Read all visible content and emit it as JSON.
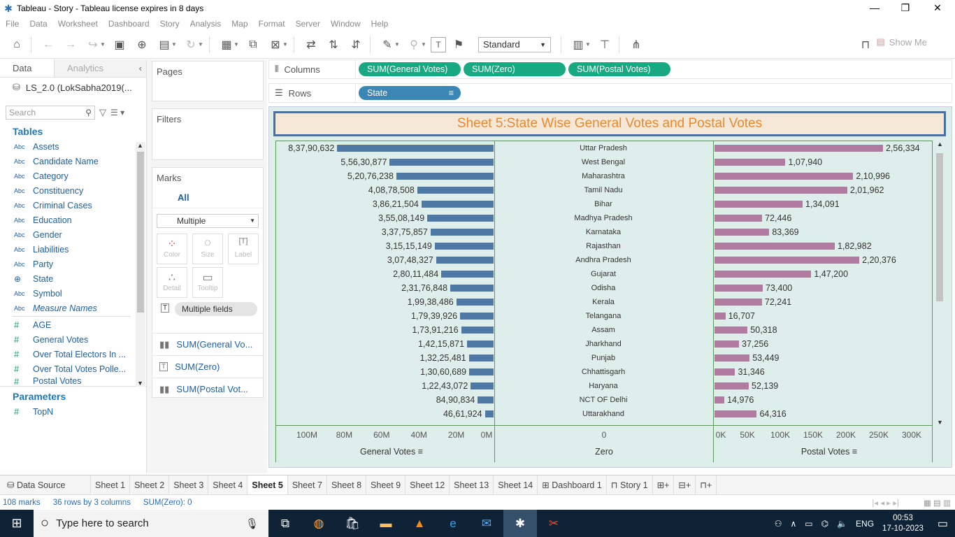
{
  "window": {
    "title": "Tableau - Story - Tableau license expires in 8 days"
  },
  "menu": [
    "File",
    "Data",
    "Worksheet",
    "Dashboard",
    "Story",
    "Analysis",
    "Map",
    "Format",
    "Server",
    "Window",
    "Help"
  ],
  "toolbar": {
    "fit_select": "Standard",
    "show_me": "Show Me"
  },
  "data_pane": {
    "tab_data": "Data",
    "tab_analytics": "Analytics",
    "datasource": "LS_2.0 (LokSabha2019(...",
    "search_placeholder": "Search",
    "tables_title": "Tables",
    "dimensions": [
      {
        "type": "Abc",
        "name": "Assets"
      },
      {
        "type": "Abc",
        "name": "Candidate Name"
      },
      {
        "type": "Abc",
        "name": "Category"
      },
      {
        "type": "Abc",
        "name": "Constituency"
      },
      {
        "type": "Abc",
        "name": "Criminal Cases"
      },
      {
        "type": "Abc",
        "name": "Education"
      },
      {
        "type": "Abc",
        "name": "Gender"
      },
      {
        "type": "Abc",
        "name": "Liabilities"
      },
      {
        "type": "Abc",
        "name": "Party"
      },
      {
        "type": "globe",
        "name": "State"
      },
      {
        "type": "Abc",
        "name": "Symbol"
      },
      {
        "type": "Abc",
        "name": "Measure Names"
      }
    ],
    "measures": [
      {
        "type": "#",
        "name": "AGE"
      },
      {
        "type": "#",
        "name": "General Votes"
      },
      {
        "type": "#",
        "name": "Over Total Electors  In ..."
      },
      {
        "type": "#",
        "name": "Over Total Votes Polle..."
      },
      {
        "type": "#",
        "name": "Postal Votes"
      }
    ],
    "parameters_title": "Parameters",
    "parameters": [
      {
        "type": "#",
        "name": "TopN"
      }
    ]
  },
  "shelves": {
    "pages": "Pages",
    "filters": "Filters",
    "marks": "Marks",
    "marks_all": "All",
    "marks_type": "Multiple",
    "mark_buttons": [
      "Color",
      "Size",
      "Label",
      "Detail",
      "Tooltip"
    ],
    "multiple_fields": "Multiple fields",
    "mark_rows": [
      "SUM(General Vo...",
      "SUM(Zero)",
      "SUM(Postal Vot..."
    ],
    "columns_label": "Columns",
    "columns_pills": [
      "SUM(General Votes)",
      "SUM(Zero)",
      "SUM(Postal Votes)"
    ],
    "rows_label": "Rows",
    "rows_pills": [
      "State"
    ]
  },
  "sheet": {
    "title": "Sheet 5:State Wise General Votes and Postal Votes"
  },
  "chart_data": {
    "type": "bar",
    "title": "Sheet 5:State Wise General Votes and Postal Votes",
    "categories": [
      "Uttar Pradesh",
      "West Bengal",
      "Maharashtra",
      "Tamil Nadu",
      "Bihar",
      "Madhya Pradesh",
      "Karnataka",
      "Rajasthan",
      "Andhra Pradesh",
      "Gujarat",
      "Odisha",
      "Kerala",
      "Telangana",
      "Assam",
      "Jharkhand",
      "Punjab",
      "Chhattisgarh",
      "Haryana",
      "NCT OF Delhi",
      "Uttarakhand"
    ],
    "series": [
      {
        "name": "General Votes",
        "values": [
          83790632,
          55630877,
          52076238,
          40878508,
          38621504,
          35508149,
          33775857,
          31515149,
          30748327,
          28011484,
          23176848,
          19938486,
          17939926,
          17391216,
          14215871,
          13225481,
          13060689,
          12243072,
          8490834,
          4661924
        ],
        "labels": [
          "8,37,90,632",
          "5,56,30,877",
          "5,20,76,238",
          "4,08,78,508",
          "3,86,21,504",
          "3,55,08,149",
          "3,37,75,857",
          "3,15,15,149",
          "3,07,48,327",
          "2,80,11,484",
          "2,31,76,848",
          "1,99,38,486",
          "1,79,39,926",
          "1,73,91,216",
          "1,42,15,871",
          "1,32,25,481",
          "1,30,60,689",
          "1,22,43,072",
          "84,90,834",
          "46,61,924"
        ]
      },
      {
        "name": "Zero",
        "values": [
          0,
          0,
          0,
          0,
          0,
          0,
          0,
          0,
          0,
          0,
          0,
          0,
          0,
          0,
          0,
          0,
          0,
          0,
          0,
          0
        ]
      },
      {
        "name": "Postal Votes",
        "values": [
          256334,
          107940,
          210996,
          201962,
          134091,
          72446,
          83369,
          182982,
          220376,
          147200,
          73400,
          72241,
          16707,
          50318,
          37256,
          53449,
          31346,
          52139,
          14976,
          64316
        ],
        "labels": [
          "2,56,334",
          "1,07,940",
          "2,10,996",
          "2,01,962",
          "1,34,091",
          "72,446",
          "83,369",
          "1,82,982",
          "2,20,376",
          "1,47,200",
          "73,400",
          "72,241",
          "16,707",
          "50,318",
          "37,256",
          "53,449",
          "31,346",
          "52,139",
          "14,976",
          "64,316"
        ]
      }
    ],
    "axes": {
      "general": {
        "label": "General Votes",
        "ticks": [
          "100M",
          "80M",
          "60M",
          "40M",
          "20M",
          "0M"
        ],
        "range": [
          0,
          100000000
        ],
        "reversed": true
      },
      "zero": {
        "label": "Zero",
        "ticks": [
          "0"
        ]
      },
      "postal": {
        "label": "Postal Votes",
        "ticks": [
          "0K",
          "50K",
          "100K",
          "150K",
          "200K",
          "250K",
          "300K"
        ],
        "range": [
          0,
          300000
        ]
      }
    },
    "colors": {
      "general": "#4e79a7",
      "postal": "#b07aa1",
      "title": "#e8892c"
    }
  },
  "sheet_tabs": [
    "Data Source",
    "Sheet 1",
    "Sheet 2",
    "Sheet 3",
    "Sheet 4",
    "Sheet 5",
    "Sheet 7",
    "Sheet 8",
    "Sheet 9",
    "Sheet 12",
    "Sheet 13",
    "Sheet 14",
    "Dashboard 1",
    "Story 1"
  ],
  "active_tab": "Sheet 5",
  "status": {
    "marks": "108 marks",
    "dims": "36 rows by 3 columns",
    "sum": "SUM(Zero): 0"
  },
  "taskbar": {
    "search_placeholder": "Type here to search",
    "lang": "ENG",
    "time": "00:53",
    "date": "17-10-2023"
  }
}
